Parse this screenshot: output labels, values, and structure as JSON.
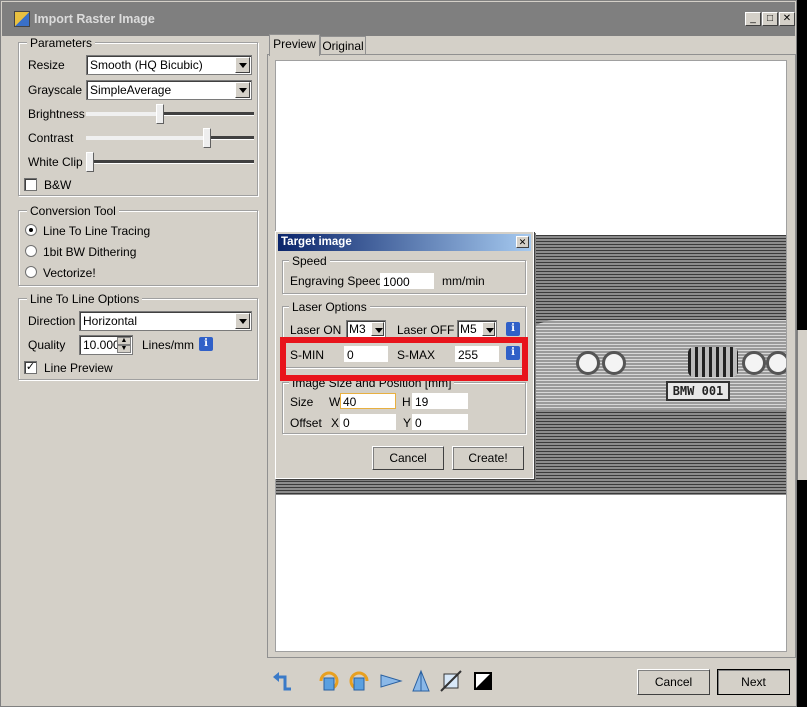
{
  "window": {
    "title": "Import Raster Image"
  },
  "parameters": {
    "group_label": "Parameters",
    "resize_label": "Resize",
    "resize_value": "Smooth (HQ Bicubic)",
    "grayscale_label": "Grayscale",
    "grayscale_value": "SimpleAverage",
    "brightness_label": "Brightness",
    "brightness_level": 0.45,
    "contrast_label": "Contrast",
    "contrast_level": 0.72,
    "white_clip_label": "White Clip",
    "white_clip_level": 0.0,
    "bw_label": "B&W",
    "bw_checked": false
  },
  "conversion_tool": {
    "group_label": "Conversion Tool",
    "options": [
      "Line To Line Tracing",
      "1bit BW Dithering",
      "Vectorize!"
    ],
    "selected": "Line To Line Tracing"
  },
  "line_options": {
    "group_label": "Line To Line Options",
    "direction_label": "Direction",
    "direction_value": "Horizontal",
    "quality_label": "Quality",
    "quality_value": "10.000",
    "quality_unit": "Lines/mm",
    "line_preview_label": "Line Preview",
    "line_preview_checked": true
  },
  "tabs": [
    "Preview",
    "Original"
  ],
  "active_tab": "Preview",
  "preview": {
    "plate_text": "BMW 001"
  },
  "target_dialog": {
    "title": "Target image",
    "speed_group": "Speed",
    "engraving_speed_label": "Engraving Speed",
    "engraving_speed_value": "1000",
    "engraving_speed_unit": "mm/min",
    "laser_group": "Laser Options",
    "laser_on_label": "Laser ON",
    "laser_on_value": "M3",
    "laser_off_label": "Laser OFF",
    "laser_off_value": "M5",
    "smin_label": "S-MIN",
    "smin_value": "0",
    "smax_label": "S-MAX",
    "smax_value": "255",
    "size_group": "Image Size and Position [mm]",
    "size_label": "Size",
    "w_label": "W",
    "w_value": "40",
    "h_label": "H",
    "h_value": "19",
    "offset_label": "Offset",
    "x_label": "X",
    "x_value": "0",
    "y_label": "Y",
    "y_value": "0",
    "cancel_label": "Cancel",
    "create_label": "Create!"
  },
  "highlight_color": "#e8141c",
  "footer": {
    "cancel_label": "Cancel",
    "next_label": "Next"
  },
  "toolbar_icons": [
    "reset-icon",
    "rotate-ccw-icon",
    "rotate-cw-icon",
    "flip-horizontal-icon",
    "flip-vertical-icon",
    "crop-icon",
    "invert-icon"
  ]
}
